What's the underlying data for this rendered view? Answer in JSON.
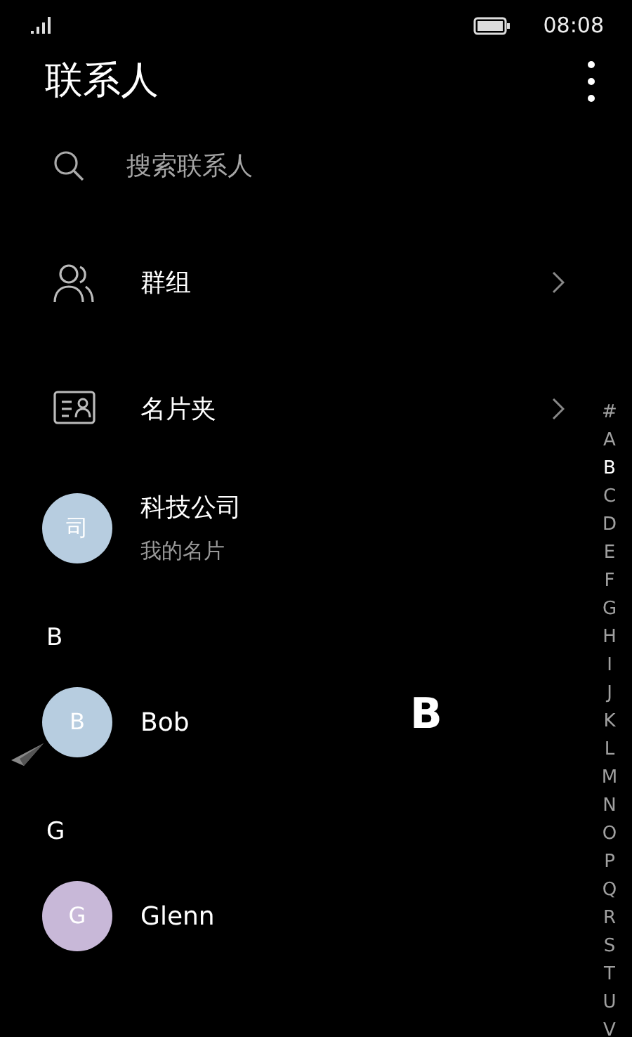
{
  "status_bar": {
    "time": "08:08"
  },
  "header": {
    "title": "联系人"
  },
  "search": {
    "placeholder": "搜索联系人"
  },
  "entries": [
    {
      "kind": "group",
      "label": "群组"
    },
    {
      "kind": "card",
      "label": "名片夹"
    }
  ],
  "my_card": {
    "avatar_text": "司",
    "color": "#b7cde0",
    "name": "科技公司",
    "subtitle": "我的名片"
  },
  "sections": [
    {
      "letter": "B",
      "contacts": [
        {
          "avatar_text": "B",
          "color": "#b7cde0",
          "name": "Bob"
        }
      ]
    },
    {
      "letter": "G",
      "contacts": [
        {
          "avatar_text": "G",
          "color": "#c8b8d8",
          "name": "Glenn"
        }
      ]
    }
  ],
  "index_popup": "B",
  "index": [
    {
      "letter": "#",
      "selected": false
    },
    {
      "letter": "A",
      "selected": false
    },
    {
      "letter": "B",
      "selected": true
    },
    {
      "letter": "C",
      "selected": false
    },
    {
      "letter": "D",
      "selected": false
    },
    {
      "letter": "E",
      "selected": false
    },
    {
      "letter": "F",
      "selected": false
    },
    {
      "letter": "G",
      "selected": false
    },
    {
      "letter": "H",
      "selected": false
    },
    {
      "letter": "I",
      "selected": false
    },
    {
      "letter": "J",
      "selected": false
    },
    {
      "letter": "K",
      "selected": false
    },
    {
      "letter": "L",
      "selected": false
    },
    {
      "letter": "M",
      "selected": false
    },
    {
      "letter": "N",
      "selected": false
    },
    {
      "letter": "O",
      "selected": false
    },
    {
      "letter": "P",
      "selected": false
    },
    {
      "letter": "Q",
      "selected": false
    },
    {
      "letter": "R",
      "selected": false
    },
    {
      "letter": "S",
      "selected": false
    },
    {
      "letter": "T",
      "selected": false
    },
    {
      "letter": "U",
      "selected": false
    },
    {
      "letter": "V",
      "selected": false
    }
  ]
}
